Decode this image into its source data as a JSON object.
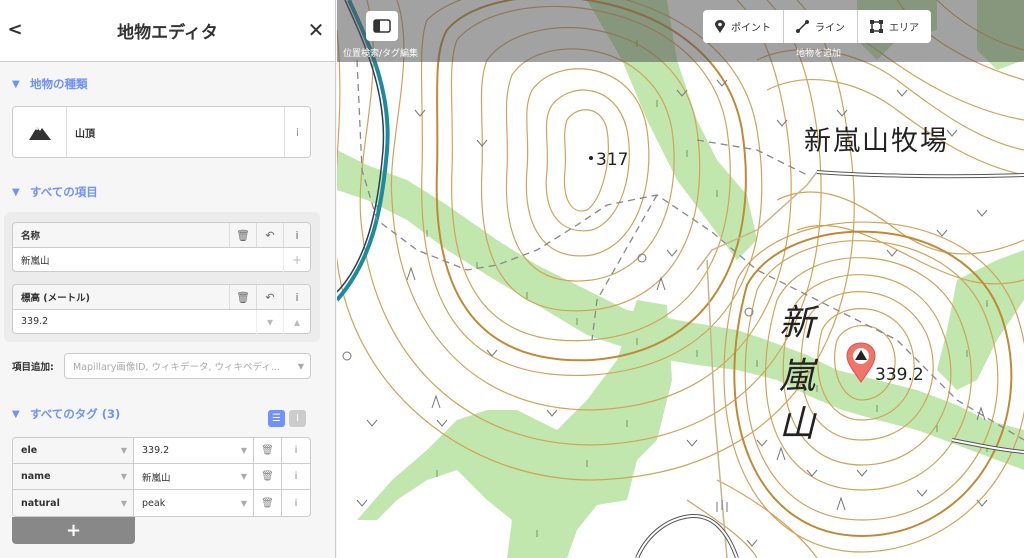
{
  "sidebar": {
    "title": "地物エディタ",
    "back_label": "<",
    "close_label": "✕",
    "preset_section": "地物の種類",
    "preset_name": "山頂",
    "fields_section": "すべての項目",
    "fields": [
      {
        "label": "名称",
        "value": "新嵐山"
      },
      {
        "label": "標高 (メートル)",
        "value": "339.2"
      }
    ],
    "add_field_label": "項目追加:",
    "add_field_placeholder": "Mapillary画像ID, ウィキデータ, ウィキペディ...",
    "tags_section": "すべてのタグ (3)",
    "tags": [
      {
        "key": "ele",
        "value": "339.2"
      },
      {
        "key": "name",
        "value": "新嵐山"
      },
      {
        "key": "natural",
        "value": "peak"
      }
    ],
    "add_tag_label": "+"
  },
  "map": {
    "sidebar_toggle_caption": "位置検索/タグ編集",
    "modes": [
      "ポイント",
      "ライン",
      "エリア"
    ],
    "modes_caption": "地物を追加",
    "labels": {
      "farm": "新嵐山牧場",
      "peak_317": "317",
      "mountain_vertical": [
        "新",
        "嵐",
        "山"
      ],
      "peak_339": "339.2"
    }
  },
  "colors": {
    "accent": "#7092ff",
    "contour": "#d1a35a",
    "forest": "#b7e3a0",
    "pin": "#f07468"
  }
}
